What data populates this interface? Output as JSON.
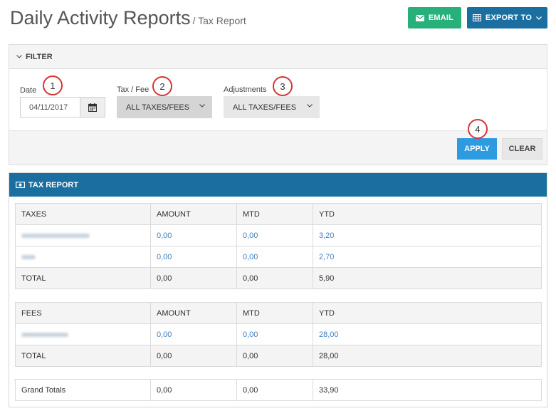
{
  "header": {
    "title": "Daily Activity Reports",
    "subtitle": "/ Tax Report",
    "email_label": "EMAIL",
    "export_label": "EXPORT TO"
  },
  "filter": {
    "title": "FILTER",
    "date_label": "Date",
    "date_value": "04/11/2017",
    "tax_label": "Tax / Fee",
    "tax_value": "ALL TAXES/FEES",
    "adj_label": "Adjustments",
    "adj_value": "ALL TAXES/FEES",
    "apply_label": "APPLY",
    "clear_label": "CLEAR"
  },
  "callouts": [
    "1",
    "2",
    "3",
    "4"
  ],
  "report": {
    "title": "TAX REPORT",
    "taxes": {
      "headers": [
        "TAXES",
        "AMOUNT",
        "MTD",
        "YTD"
      ],
      "rows": [
        [
          "",
          "0,00",
          "0,00",
          "3,20"
        ],
        [
          "",
          "0,00",
          "0,00",
          "2,70"
        ]
      ],
      "total": [
        "TOTAL",
        "0,00",
        "0,00",
        "5,90"
      ]
    },
    "fees": {
      "headers": [
        "FEES",
        "AMOUNT",
        "MTD",
        "YTD"
      ],
      "rows": [
        [
          "",
          "0,00",
          "0,00",
          "28,00"
        ]
      ],
      "total": [
        "TOTAL",
        "0,00",
        "0,00",
        "28,00"
      ]
    },
    "grand": [
      "Grand Totals",
      "0,00",
      "0,00",
      "33,90"
    ]
  },
  "colors": {
    "email_button": "#27b07a",
    "primary_blue": "#1a6fa0",
    "apply_button": "#2d9be0",
    "link": "#3f7fc1",
    "callout_ring": "#d73434"
  }
}
